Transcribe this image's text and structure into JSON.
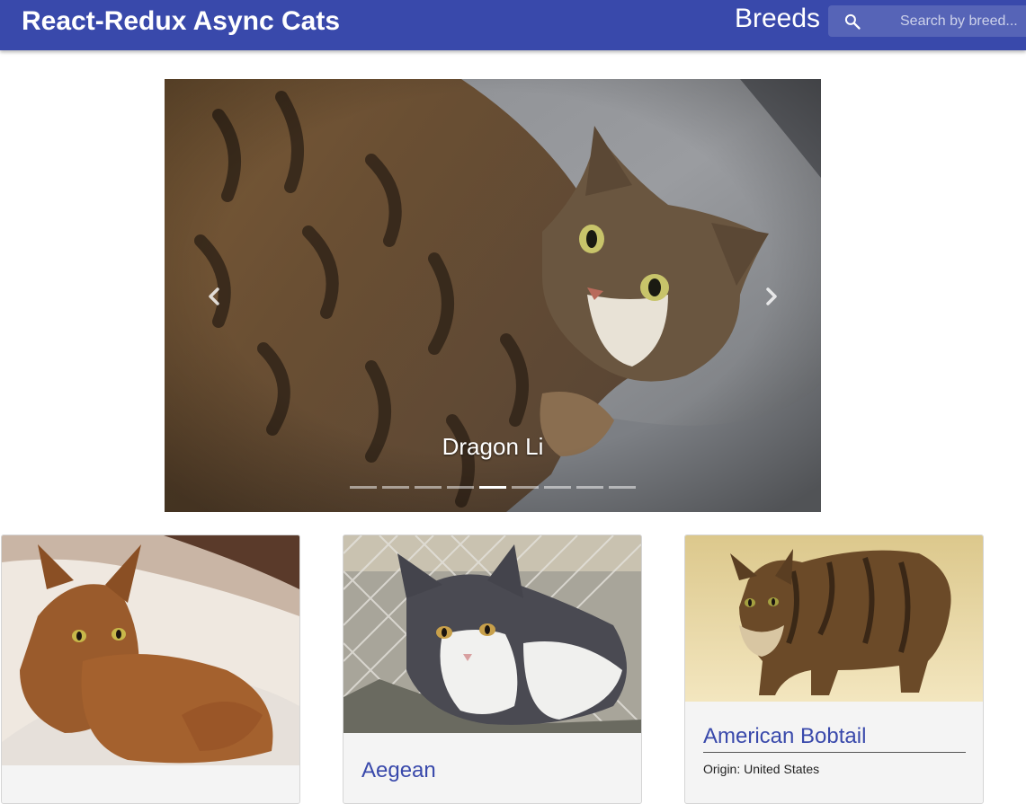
{
  "app": {
    "title": "React-Redux Async Cats",
    "nav_breeds": "Breeds"
  },
  "search": {
    "placeholder": "Search by breed...",
    "icon": "search-icon"
  },
  "carousel": {
    "caption": "Dragon Li",
    "indicator_count": 9,
    "active_index": 4,
    "prev_icon": "chevron-left-icon",
    "next_icon": "chevron-right-icon"
  },
  "cards": [
    {
      "title": "",
      "origin": ""
    },
    {
      "title": "Aegean",
      "origin": ""
    },
    {
      "title": "American Bobtail",
      "origin": "Origin: United States"
    }
  ],
  "colors": {
    "appbar": "#3949ab",
    "link": "#3949ab"
  }
}
